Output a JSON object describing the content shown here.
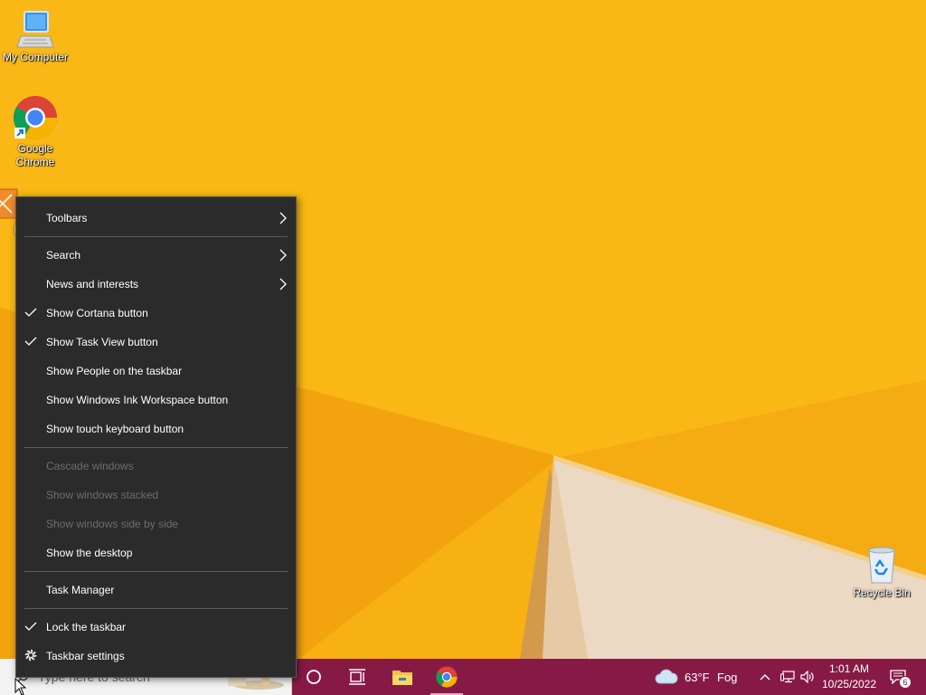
{
  "desktop": {
    "icons": {
      "my_computer": "My Computer",
      "chrome_line1": "Google",
      "chrome_line2": "Chrome",
      "partial_label": "Da",
      "recycle_bin": "Recycle Bin"
    }
  },
  "context_menu": {
    "toolbars": "Toolbars",
    "search": "Search",
    "news_and_interests": "News and interests",
    "show_cortana_button": "Show Cortana button",
    "show_task_view_button": "Show Task View button",
    "show_people_on_taskbar": "Show People on the taskbar",
    "show_windows_ink_workspace": "Show Windows Ink Workspace button",
    "show_touch_keyboard": "Show touch keyboard button",
    "cascade_windows": "Cascade windows",
    "show_windows_stacked": "Show windows stacked",
    "show_windows_side_by_side": "Show windows side by side",
    "show_the_desktop": "Show the desktop",
    "task_manager": "Task Manager",
    "lock_the_taskbar": "Lock the taskbar",
    "taskbar_settings": "Taskbar settings"
  },
  "taskbar": {
    "search_placeholder": "Type here to search",
    "weather_temp": "63°F",
    "weather_condition": "Fog",
    "time": "1:01 AM",
    "date": "10/25/2022",
    "notification_count": "6"
  },
  "colors": {
    "taskbar": "#871a45",
    "wallpaper": "#f6ad10",
    "menu_background": "#2b2b2b"
  }
}
